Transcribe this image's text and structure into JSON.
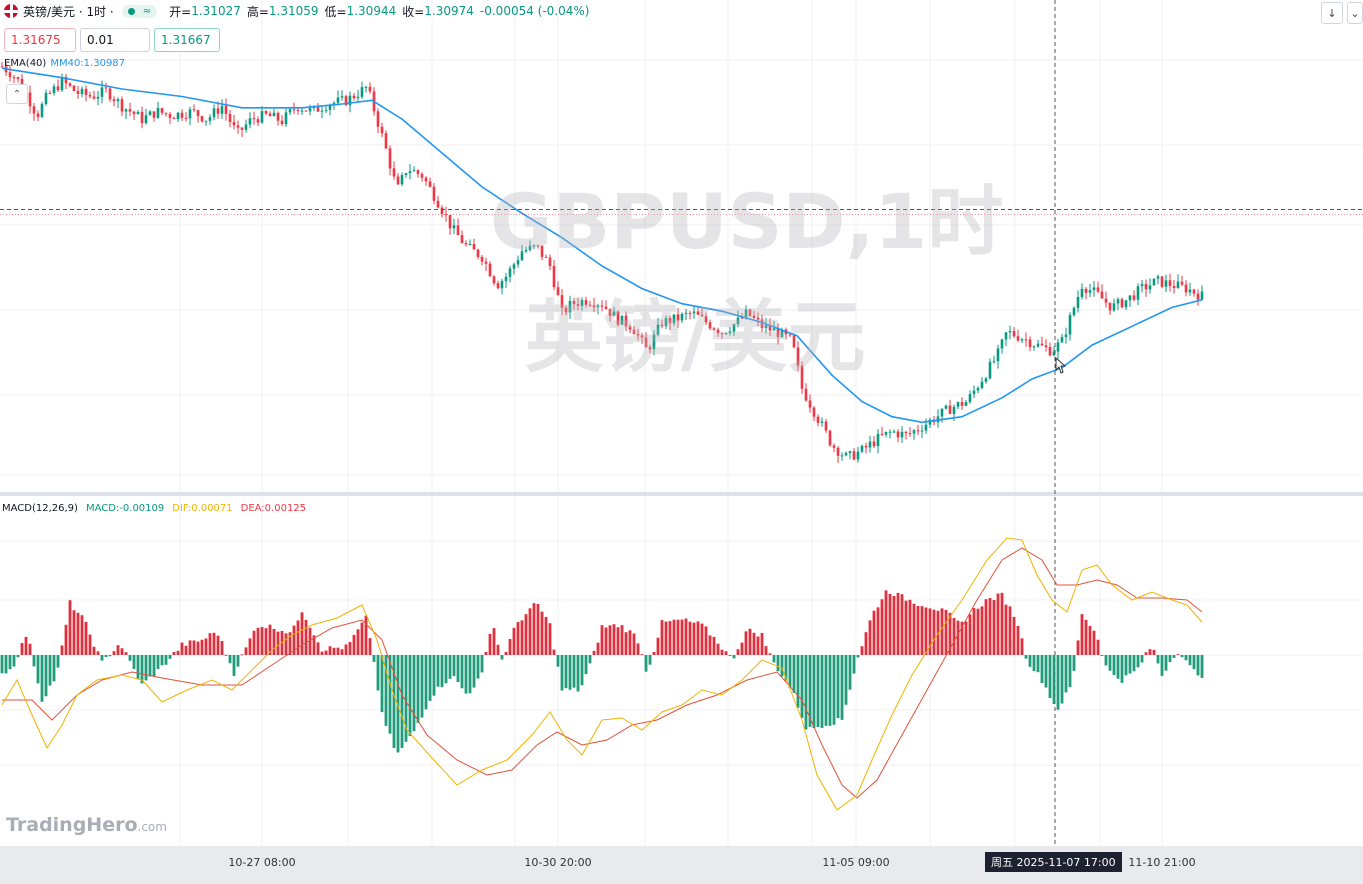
{
  "header": {
    "symbol": "英镑/美元 · 1时 ·",
    "open_label": "开=",
    "open": "1.31027",
    "high_label": "高=",
    "high": "1.31059",
    "low_label": "低=",
    "low": "1.30944",
    "close_label": "收=",
    "close": "1.30974",
    "change": "-0.00054 (-0.04%)"
  },
  "trade": {
    "sell_price": "1.31675",
    "quantity": "0.01",
    "buy_price": "1.31667"
  },
  "ema": {
    "name": "EMA(40)",
    "value": "MM40:1.30987"
  },
  "macd": {
    "name": "MACD(12,26,9)",
    "macd": "MACD:-0.00109",
    "dif": "DIF:0.00071",
    "dea": "DEA:0.00125"
  },
  "watermark": {
    "line1": "GBPUSD,1时",
    "line2": "英镑/美元"
  },
  "logo": {
    "name": "TradingHero",
    "suffix": ".com"
  },
  "xaxis": {
    "labels": [
      "10-27 08:00",
      "10-30 20:00",
      "11-05 09:00",
      "11-10 21:00"
    ],
    "crosshair_label": "周五 2025-11-07  17:00"
  },
  "colors": {
    "up": "#089981",
    "down": "#f23645",
    "ema": "#2196f3",
    "dif": "#f0b400",
    "dea": "#e0533c",
    "hist_up": "#e0303e",
    "hist_down": "#1f9c7a"
  },
  "chart_data": [
    {
      "type": "candlestick",
      "title": "GBPUSD,1时",
      "ema_name": "EMA(40)",
      "close_path": [
        [
          0,
          1.3176
        ],
        [
          10,
          1.3172
        ],
        [
          20,
          1.3166
        ],
        [
          35,
          1.315
        ],
        [
          45,
          1.316
        ],
        [
          60,
          1.3168
        ],
        [
          75,
          1.3162
        ],
        [
          90,
          1.316
        ],
        [
          105,
          1.3163
        ],
        [
          120,
          1.3155
        ],
        [
          140,
          1.3148
        ],
        [
          155,
          1.3152
        ],
        [
          170,
          1.315
        ],
        [
          190,
          1.3152
        ],
        [
          205,
          1.3148
        ],
        [
          220,
          1.3155
        ],
        [
          235,
          1.314
        ],
        [
          250,
          1.3148
        ],
        [
          265,
          1.315
        ],
        [
          280,
          1.3147
        ],
        [
          295,
          1.3155
        ],
        [
          310,
          1.3152
        ],
        [
          325,
          1.3156
        ],
        [
          345,
          1.3158
        ],
        [
          365,
          1.3165
        ],
        [
          375,
          1.3148
        ],
        [
          385,
          1.313
        ],
        [
          395,
          1.311
        ],
        [
          405,
          1.3122
        ],
        [
          420,
          1.3118
        ],
        [
          435,
          1.3105
        ],
        [
          450,
          1.309
        ],
        [
          465,
          1.308
        ],
        [
          480,
          1.3075
        ],
        [
          495,
          1.306
        ],
        [
          505,
          1.3065
        ],
        [
          520,
          1.3078
        ],
        [
          535,
          1.308
        ],
        [
          548,
          1.307
        ],
        [
          560,
          1.3045
        ],
        [
          570,
          1.305
        ],
        [
          585,
          1.3052
        ],
        [
          600,
          1.305
        ],
        [
          615,
          1.3042
        ],
        [
          630,
          1.3038
        ],
        [
          645,
          1.3025
        ],
        [
          660,
          1.304
        ],
        [
          675,
          1.3042
        ],
        [
          690,
          1.3045
        ],
        [
          705,
          1.304
        ],
        [
          720,
          1.3035
        ],
        [
          735,
          1.304
        ],
        [
          745,
          1.3045
        ],
        [
          760,
          1.3038
        ],
        [
          775,
          1.3035
        ],
        [
          790,
          1.303
        ],
        [
          800,
          1.3005
        ],
        [
          815,
          1.299
        ],
        [
          830,
          1.2975
        ],
        [
          845,
          1.2968
        ],
        [
          860,
          1.2972
        ],
        [
          875,
          1.2978
        ],
        [
          890,
          1.2982
        ],
        [
          905,
          1.298
        ],
        [
          920,
          1.2985
        ],
        [
          935,
          1.299
        ],
        [
          950,
          1.2995
        ],
        [
          965,
          1.2998
        ],
        [
          980,
          1.301
        ],
        [
          995,
          1.3022
        ],
        [
          1005,
          1.3035
        ],
        [
          1020,
          1.3032
        ],
        [
          1035,
          1.3028
        ],
        [
          1050,
          1.3025
        ],
        [
          1060,
          1.303
        ],
        [
          1070,
          1.3045
        ],
        [
          1080,
          1.306
        ],
        [
          1095,
          1.3055
        ],
        [
          1110,
          1.3048
        ],
        [
          1125,
          1.3052
        ],
        [
          1140,
          1.3058
        ],
        [
          1155,
          1.3062
        ],
        [
          1170,
          1.306
        ],
        [
          1185,
          1.3058
        ],
        [
          1200,
          1.3054
        ]
      ],
      "ema_path": [
        [
          0,
          1.3175
        ],
        [
          60,
          1.317
        ],
        [
          120,
          1.3164
        ],
        [
          180,
          1.316
        ],
        [
          240,
          1.3154
        ],
        [
          300,
          1.3154
        ],
        [
          340,
          1.3156
        ],
        [
          370,
          1.3158
        ],
        [
          400,
          1.3148
        ],
        [
          440,
          1.313
        ],
        [
          480,
          1.3112
        ],
        [
          520,
          1.3098
        ],
        [
          560,
          1.3085
        ],
        [
          600,
          1.307
        ],
        [
          640,
          1.3058
        ],
        [
          680,
          1.305
        ],
        [
          720,
          1.3046
        ],
        [
          760,
          1.304
        ],
        [
          795,
          1.3033
        ],
        [
          830,
          1.3012
        ],
        [
          860,
          1.2998
        ],
        [
          890,
          1.299
        ],
        [
          920,
          1.2987
        ],
        [
          960,
          1.299
        ],
        [
          1000,
          1.3
        ],
        [
          1030,
          1.301
        ],
        [
          1060,
          1.3016
        ],
        [
          1090,
          1.3028
        ],
        [
          1130,
          1.3038
        ],
        [
          1170,
          1.3048
        ],
        [
          1200,
          1.3052
        ]
      ],
      "ema_last": 1.30987,
      "crosshair_price": 1.31,
      "current_price": 1.30974
    },
    {
      "type": "macd",
      "title": "MACD(12,26,9)",
      "series": [
        {
          "name": "MACD",
          "last": -0.00109
        },
        {
          "name": "DIF",
          "last": 0.00071
        },
        {
          "name": "DEA",
          "last": 0.00125
        }
      ]
    }
  ]
}
